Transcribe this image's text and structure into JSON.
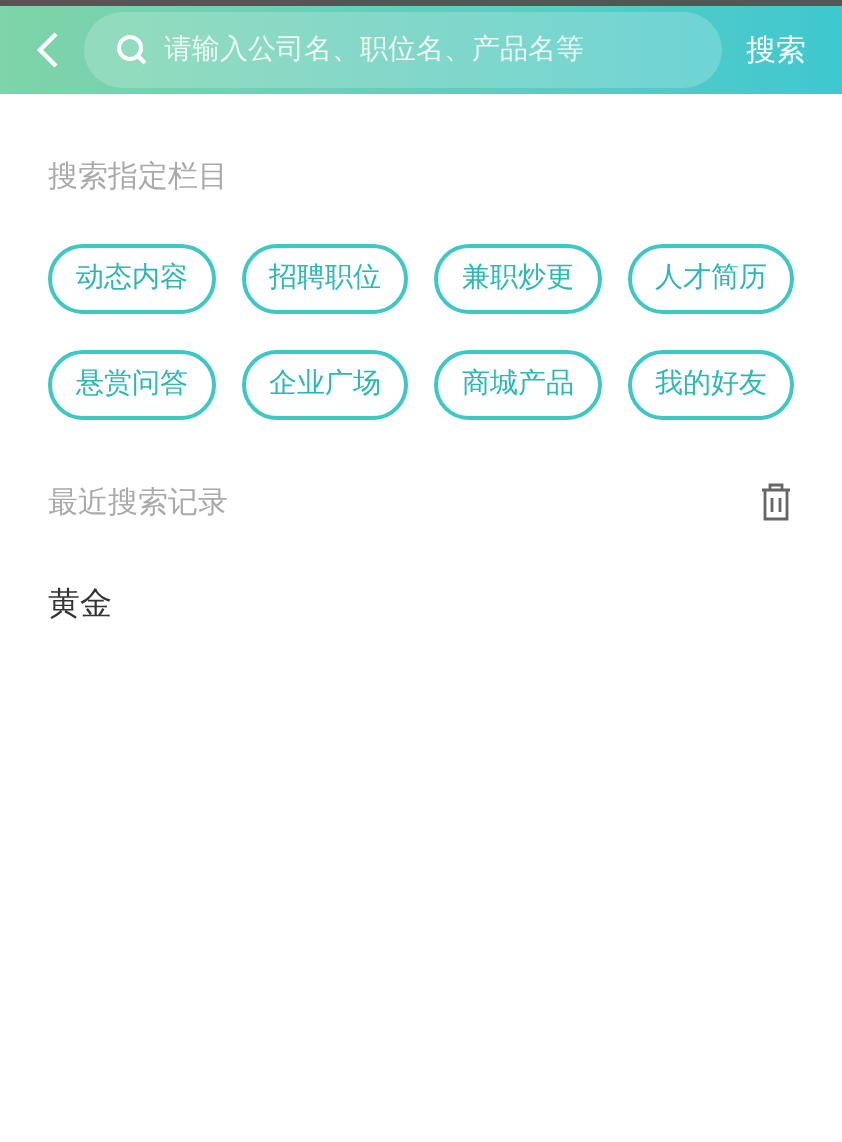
{
  "header": {
    "search": {
      "placeholder": "请输入公司名、职位名、产品名等"
    },
    "search_button": "搜索"
  },
  "categories": {
    "title": "搜索指定栏目",
    "items": [
      "动态内容",
      "招聘职位",
      "兼职炒更",
      "人才简历",
      "悬赏问答",
      "企业广场",
      "商城产品",
      "我的好友"
    ]
  },
  "recent": {
    "title": "最近搜索记录",
    "items": [
      "黄金"
    ]
  }
}
